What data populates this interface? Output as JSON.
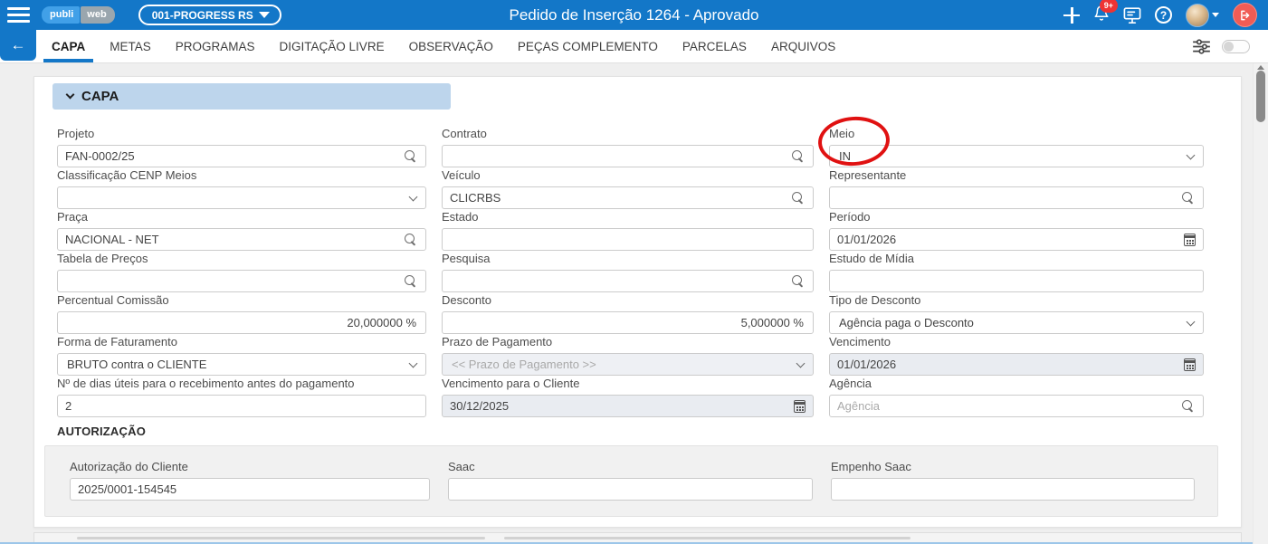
{
  "topbar": {
    "logo_primary": "publi",
    "logo_secondary": "web",
    "company_selector": "001-PROGRESS RS",
    "title": "Pedido de Inserção 1264 - Aprovado",
    "notification_badge": "9+",
    "help_label": "?"
  },
  "tabbar": {
    "back_arrow": "←",
    "tabs": [
      {
        "label": "CAPA",
        "active": true
      },
      {
        "label": "METAS",
        "active": false
      },
      {
        "label": "PROGRAMAS",
        "active": false
      },
      {
        "label": "DIGITAÇÃO LIVRE",
        "active": false
      },
      {
        "label": "OBSERVAÇÃO",
        "active": false
      },
      {
        "label": "PEÇAS COMPLEMENTO",
        "active": false
      },
      {
        "label": "PARCELAS",
        "active": false
      },
      {
        "label": "ARQUIVOS",
        "active": false
      }
    ]
  },
  "capa": {
    "section_title": "CAPA",
    "fields": {
      "projeto": {
        "label": "Projeto",
        "value": "FAN-0002/25",
        "icon": "search-icon"
      },
      "contrato": {
        "label": "Contrato",
        "value": "",
        "icon": "search-icon"
      },
      "meio": {
        "label": "Meio",
        "value": "IN",
        "icon": "chevron-down-icon"
      },
      "classificacao_cenp": {
        "label": "Classificação CENP Meios",
        "value": "",
        "icon": "chevron-down-icon"
      },
      "veiculo": {
        "label": "Veículo",
        "value": "CLICRBS",
        "icon": "search-icon"
      },
      "representante": {
        "label": "Representante",
        "value": "",
        "icon": "search-icon"
      },
      "praca": {
        "label": "Praça",
        "value": "NACIONAL - NET",
        "icon": "search-icon"
      },
      "estado": {
        "label": "Estado",
        "value": ""
      },
      "periodo": {
        "label": "Período",
        "value": "01/01/2026",
        "icon": "calendar-icon"
      },
      "tabela_precos": {
        "label": "Tabela de Preços",
        "value": "",
        "icon": "search-icon"
      },
      "pesquisa": {
        "label": "Pesquisa",
        "value": "",
        "icon": "search-icon"
      },
      "estudo_midia": {
        "label": "Estudo de Mídia",
        "value": ""
      },
      "percentual_comissao": {
        "label": "Percentual Comissão",
        "value": "20,000000 %"
      },
      "desconto": {
        "label": "Desconto",
        "value": "5,000000 %"
      },
      "tipo_desconto": {
        "label": "Tipo de Desconto",
        "value": "Agência paga o Desconto",
        "icon": "chevron-down-icon"
      },
      "forma_faturamento": {
        "label": "Forma de Faturamento",
        "value": "BRUTO contra o CLIENTE",
        "icon": "chevron-down-icon"
      },
      "prazo_pagamento": {
        "label": "Prazo de Pagamento",
        "placeholder": "<< Prazo de Pagamento >>",
        "icon": "chevron-down-icon",
        "disabled": true
      },
      "vencimento": {
        "label": "Vencimento",
        "value": "01/01/2026",
        "icon": "calendar-icon",
        "disabled": true
      },
      "dias_uteis": {
        "label": "Nº de dias úteis para o recebimento antes do pagamento",
        "value": "2"
      },
      "vencimento_cliente": {
        "label": "Vencimento para o Cliente",
        "value": "30/12/2025",
        "icon": "calendar-icon",
        "disabled": true
      },
      "agencia": {
        "label": "Agência",
        "value": "",
        "placeholder": "Agência",
        "icon": "search-icon"
      }
    }
  },
  "autorizacao": {
    "section_title": "AUTORIZAÇÃO",
    "fields": {
      "autorizacao_cliente": {
        "label": "Autorização do Cliente",
        "value": "2025/0001-154545"
      },
      "saac": {
        "label": "Saac",
        "value": ""
      },
      "empenho_saac": {
        "label": "Empenho Saac",
        "value": ""
      }
    }
  },
  "annotation": {
    "type": "hand-drawn-ellipse",
    "color": "#e01111",
    "target_field": "Meio"
  },
  "colors": {
    "accent_blue": "#1377c8",
    "section_header_bg": "#bdd5ec",
    "disabled_field_bg": "#e9ecf1",
    "badge_red": "#e33333"
  }
}
